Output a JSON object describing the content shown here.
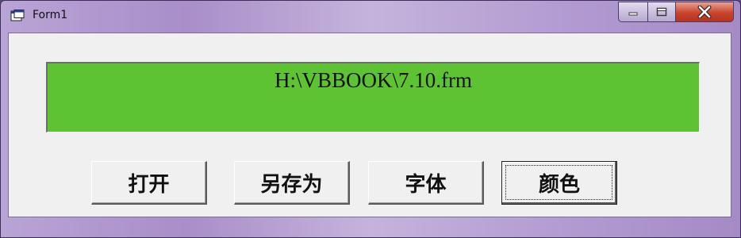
{
  "window": {
    "title": "Form1",
    "controls": {
      "minimize": "minimize-icon",
      "maximize": "maximize-icon",
      "close": "close-icon"
    }
  },
  "label": {
    "text": "H:\\VBBOOK\\7.10.frm",
    "background_color": "#5ec332"
  },
  "buttons": {
    "open": "打开",
    "save_as": "另存为",
    "font": "字体",
    "color": "颜色"
  },
  "focused_button": "color"
}
